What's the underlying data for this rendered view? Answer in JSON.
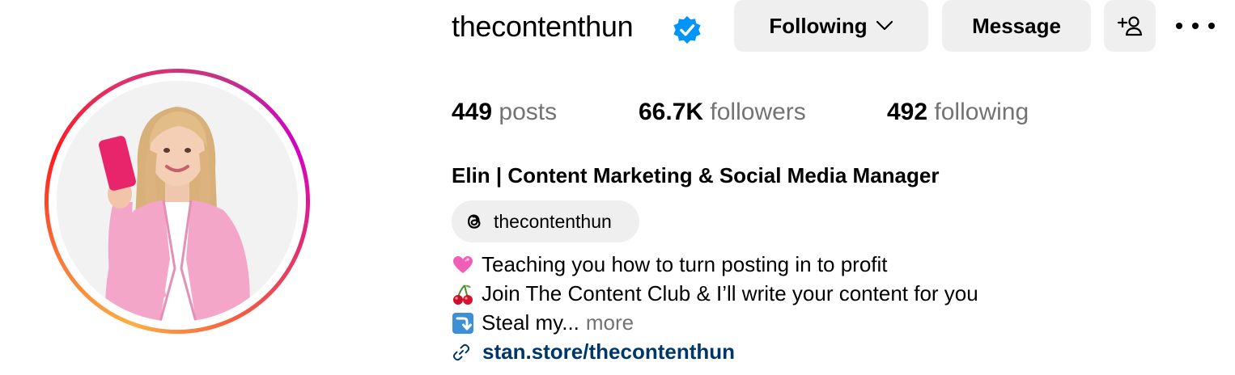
{
  "profile": {
    "username": "thecontenthun",
    "verified": true,
    "full_name": "Elin | Content Marketing & Social Media Manager"
  },
  "actions": {
    "following_label": "Following",
    "message_label": "Message"
  },
  "stats": {
    "posts_count": "449",
    "posts_label": "posts",
    "followers_count": "66.7K",
    "followers_label": "followers",
    "following_count": "492",
    "following_label": "following"
  },
  "threads": {
    "handle": "thecontenthun"
  },
  "bio": {
    "lines": [
      {
        "emoji": "pink-heart-icon",
        "text": "Teaching you how to turn posting in to profit"
      },
      {
        "emoji": "cherries-icon",
        "text": "Join The Content Club & I’ll write your content for you"
      },
      {
        "emoji": "down-right-arrow-icon",
        "text": "Steal my..."
      }
    ],
    "more_label": "more"
  },
  "link": {
    "text": "stan.store/thecontenthun"
  },
  "colors": {
    "verified_blue": "#0095f6",
    "link_blue": "#00376b",
    "muted_gray": "#737373",
    "button_gray": "#efefef",
    "pink_blazer": "#f4a6c9",
    "phone_pink": "#e8256a"
  }
}
